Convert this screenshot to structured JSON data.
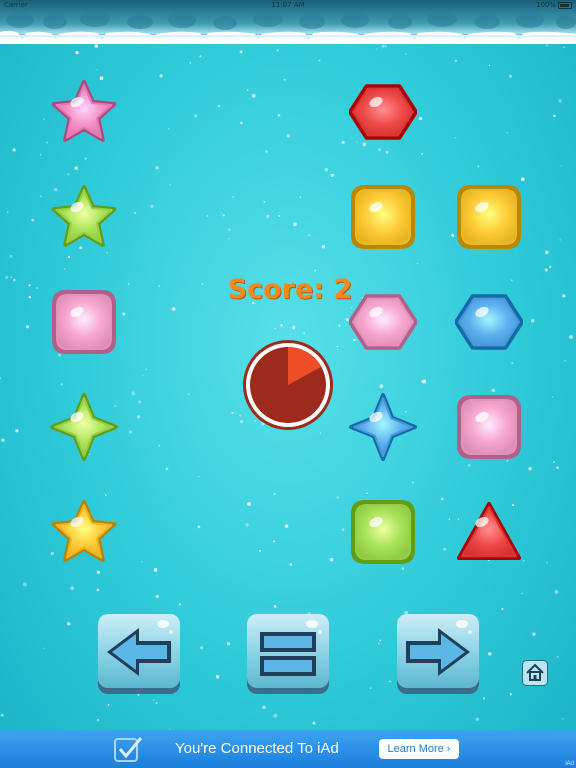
{
  "status_bar": {
    "carrier": "Carrier",
    "time": "11:07 AM",
    "battery": "100%"
  },
  "score": {
    "label": "Score: 2"
  },
  "timer": {
    "remaining_fraction": 0.83,
    "elapsed_fraction": 0.17,
    "colors": {
      "base": "#9e2a1c",
      "wedge": "#ee4d25"
    }
  },
  "board": {
    "left_column": [
      {
        "shape": "star",
        "color": "#f58ec4"
      },
      {
        "shape": "star",
        "color": "#a9e35a"
      },
      {
        "shape": "rounded-square",
        "color": "#f7a6cf"
      },
      {
        "shape": "four-point-star",
        "color": "#a9e35a"
      },
      {
        "shape": "star",
        "color": "#ffc93a"
      }
    ],
    "right_grid": [
      {
        "shape": "hexagon",
        "color": "#ef4a4a"
      },
      null,
      {
        "shape": "rounded-square",
        "color": "#ffcd3a"
      },
      {
        "shape": "rounded-square",
        "color": "#ffcd3a"
      },
      {
        "shape": "hexagon",
        "color": "#f7a6cf"
      },
      {
        "shape": "hexagon",
        "color": "#5cb0ef"
      },
      {
        "shape": "four-point-star",
        "color": "#5cb0ef"
      },
      {
        "shape": "rounded-square",
        "color": "#f7a6cf"
      },
      {
        "shape": "rounded-square",
        "color": "#a9e35a"
      },
      {
        "shape": "triangle",
        "color": "#ef4a4a"
      }
    ]
  },
  "controls": [
    {
      "name": "left-arrow-button",
      "icon": "left-arrow-icon"
    },
    {
      "name": "pause-button",
      "icon": "pause-icon"
    },
    {
      "name": "right-arrow-button",
      "icon": "right-arrow-icon"
    },
    {
      "name": "home-button",
      "icon": "home-icon"
    }
  ],
  "ad": {
    "text": "You're Connected To iAd",
    "button_label": "Learn More ›",
    "corner_label": "iAd"
  }
}
